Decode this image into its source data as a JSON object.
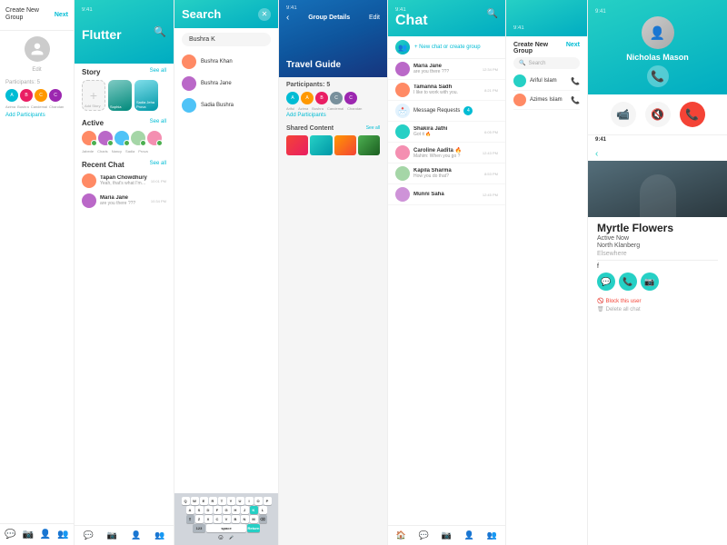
{
  "app": {
    "panels": {
      "panel1": {
        "header": {
          "create": "Create New Group",
          "next": "Next"
        },
        "edit_label": "Edit",
        "participants": "Participants: 5",
        "names": [
          "Azima",
          "Bushra",
          "Candemal",
          "Chandan"
        ],
        "add_btn": "Add Participants",
        "nav": [
          "💬",
          "📷",
          "👤",
          "👥"
        ]
      },
      "panel2": {
        "time": "9:41",
        "title": "Flutter",
        "story": {
          "label": "Story",
          "see_all": "See all"
        },
        "stories": [
          {
            "label": "Add Story"
          },
          {
            "label": "Sophia"
          },
          {
            "label": "Sadia Jeha Prova"
          }
        ],
        "active": {
          "label": "Active",
          "see_all": "See all"
        },
        "active_contacts": [
          "Jabede",
          "Charis",
          "Nancy",
          "Sadia",
          "Prova"
        ],
        "recent": {
          "label": "Recent Chat",
          "see_all": "See all"
        },
        "chats": [
          {
            "name": "Tapan Chowdhury",
            "msg": "Yeah, that's what I'm saying",
            "time": "10:01 PM"
          },
          {
            "name": "Maria Jane",
            "msg": "are you there ???",
            "time": "10:34 PM"
          }
        ]
      },
      "panel3": {
        "title": "Search",
        "query": "Bushra K",
        "results": [
          {
            "name": "Bushra Khan"
          },
          {
            "name": "Bushra Jane"
          },
          {
            "name": "Sadia Bushra"
          }
        ],
        "keyboard": {
          "rows": [
            [
              "Q",
              "W",
              "E",
              "R",
              "T",
              "Y",
              "U",
              "I",
              "O",
              "P"
            ],
            [
              "A",
              "S",
              "D",
              "F",
              "G",
              "H",
              "J",
              "K",
              "L"
            ],
            [
              "⇧",
              "Z",
              "X",
              "C",
              "V",
              "B",
              "N",
              "M",
              "⌫"
            ],
            [
              "123",
              "space",
              "Return"
            ]
          ]
        }
      },
      "panel4": {
        "time": "9:41",
        "title": "Group Details",
        "edit": "Edit",
        "hero_title": "Travel Guide",
        "participants": "Participants: 5",
        "names": [
          "Ariful",
          "Azima",
          "Bushra",
          "Candemal",
          "Chandan"
        ],
        "add_btn": "Add Participants",
        "shared": {
          "label": "Shared Content",
          "see_all": "See all"
        }
      },
      "panel5": {
        "time": "9:41",
        "title": "Chat",
        "new_group": "+ New chat or create group",
        "message_requests": "Message Requests",
        "chats": [
          {
            "name": "Maria Jane",
            "msg": "are you there ???",
            "time": "12:34 PM"
          },
          {
            "name": "Tamanna Sadh",
            "msg": "I like to work with you.",
            "time": "8:21 PM"
          },
          {
            "name": "Shakira Jathi",
            "msg": "Got it 🔥",
            "time": "6:05 PM"
          },
          {
            "name": "Caroline Aadita 🔥",
            "msg": "Mahim: When you go ?",
            "time": "12:43 PM"
          },
          {
            "name": "Kapila Sharma",
            "msg": "How you do that?",
            "time": "8:53 PM"
          },
          {
            "name": "Munni Saha",
            "msg": "",
            "time": "12:45 PM"
          }
        ]
      },
      "panel6": {
        "time": "9:41",
        "create": "Create New Group",
        "next": "Next",
        "search_placeholder": "Search",
        "contacts": [
          {
            "name": "Ariful Islam"
          },
          {
            "name": "Azimes Islam"
          }
        ]
      },
      "panel7": {
        "top": {
          "time": "9:41",
          "back": "‹"
        },
        "profile": {
          "name": "Nicholas Mason",
          "actions": [
            "📹",
            "🔇",
            "📞"
          ],
          "info": {
            "label1": "Active Now",
            "value1": "North Klanberg",
            "label2": "Elsewhere"
          }
        },
        "myrtle": {
          "name": "Myrtle Flowers",
          "location1": "Active Now",
          "location2": "North Klanberg",
          "elsewhere": "Elsewhere",
          "block": "Block this user",
          "delete": "Delete all chat"
        }
      }
    }
  }
}
